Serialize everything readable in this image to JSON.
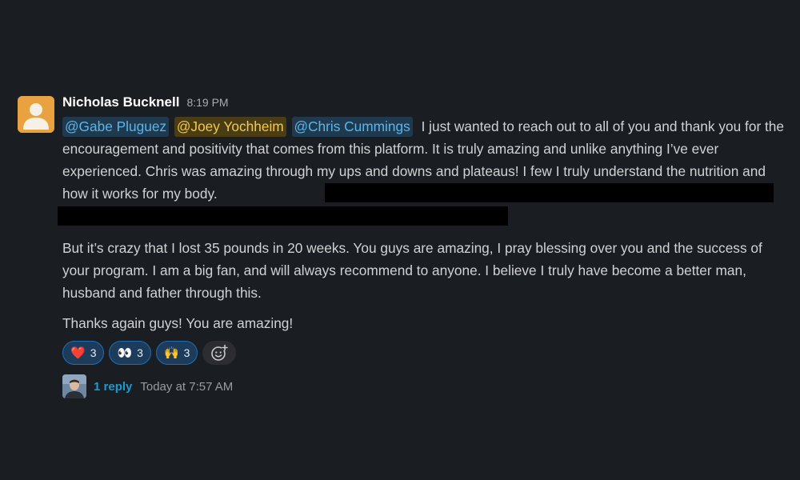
{
  "message": {
    "author": "Nicholas Bucknell",
    "time": "8:19 PM",
    "mentions": [
      "@Gabe Pluguez",
      "@Joey Yochheim",
      "@Chris Cummings"
    ],
    "paragraph1": "I just wanted to reach out to all of you and thank you for the encouragement and positivity that comes from this platform. It is truly amazing and unlike anything I’ve ever experienced. Chris was amazing through my ups and downs and plateaus! I few I truly understand the nutrition and how it works for my body.",
    "paragraph2": "But it’s crazy that I lost 35 pounds in 20 weeks. You guys are amazing, I pray blessing over you and the success of your program. I am a big fan, and will always recommend to anyone. I believe I truly have become a better man, husband and father through this.",
    "paragraph3": "Thanks again guys! You are amazing!"
  },
  "reactions": [
    {
      "emoji": "❤️",
      "icon": "red-heart-icon",
      "count": "3"
    },
    {
      "emoji": "👀",
      "icon": "eyes-icon",
      "count": "3"
    },
    {
      "emoji": "🙌",
      "icon": "raised-hands-icon",
      "count": "3"
    }
  ],
  "thread": {
    "reply_count": "1 reply",
    "last_reply": "Today at 7:57 AM"
  },
  "colors": {
    "background": "#1a1d21",
    "mention_blue": "#5bb5ea",
    "mention_yellow": "#f2c94c",
    "link": "#1d9bd1",
    "avatar": "#e8a23f"
  }
}
